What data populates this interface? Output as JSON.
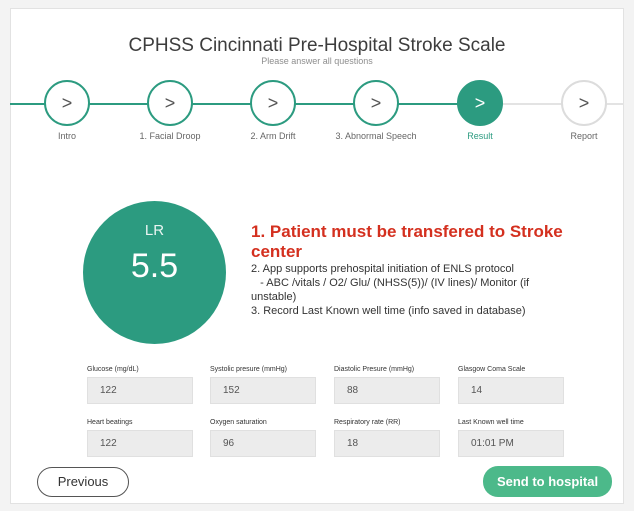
{
  "header": {
    "title": "CPHSS Cincinnati Pre-Hospital Stroke Scale",
    "subtitle": "Please answer all questions"
  },
  "colors": {
    "accent": "#2c9b80",
    "alert": "#d4301f",
    "send_button": "#4cb98a"
  },
  "steps": [
    {
      "icon": "chevron-right-icon",
      "glyph": ">",
      "label": "Intro",
      "state": "done"
    },
    {
      "icon": "chevron-right-icon",
      "glyph": ">",
      "label": "1. Facial Droop",
      "state": "done"
    },
    {
      "icon": "chevron-right-icon",
      "glyph": ">",
      "label": "2. Arm Drift",
      "state": "done"
    },
    {
      "icon": "chevron-right-icon",
      "glyph": ">",
      "label": "3. Abnormal Speech",
      "state": "done"
    },
    {
      "icon": "chevron-right-icon",
      "glyph": ">",
      "label": "Result",
      "state": "current"
    },
    {
      "icon": "chevron-right-icon",
      "glyph": ">",
      "label": "Report",
      "state": "future"
    }
  ],
  "score": {
    "label": "LR",
    "value": "5.5"
  },
  "result": {
    "headline": "1. Patient must be transfered to Stroke center",
    "line2": "2. App supports prehospital initiation of ENLS protocol",
    "line2b": "   - ABC /vitals / O2/ Glu/ (NHSS(5))/ (IV lines)/ Monitor (if unstable)",
    "line3": "3. Record Last Known well time (info saved in database)"
  },
  "fields": [
    {
      "label": "Glucose (mg/dL)",
      "value": "122"
    },
    {
      "label": "Systolic presure (mmHg)",
      "value": "152"
    },
    {
      "label": "Diastolic Presure (mmHg)",
      "value": "88"
    },
    {
      "label": "Glasgow Coma Scale",
      "value": "14"
    },
    {
      "label": "Heart beatings",
      "value": "122"
    },
    {
      "label": "Oxygen saturation",
      "value": "96"
    },
    {
      "label": "Respiratory rate (RR)",
      "value": "18"
    },
    {
      "label": "Last Known well time",
      "value": "01:01 PM"
    }
  ],
  "footer": {
    "previous_label": "Previous",
    "send_label": "Send to hospital"
  }
}
